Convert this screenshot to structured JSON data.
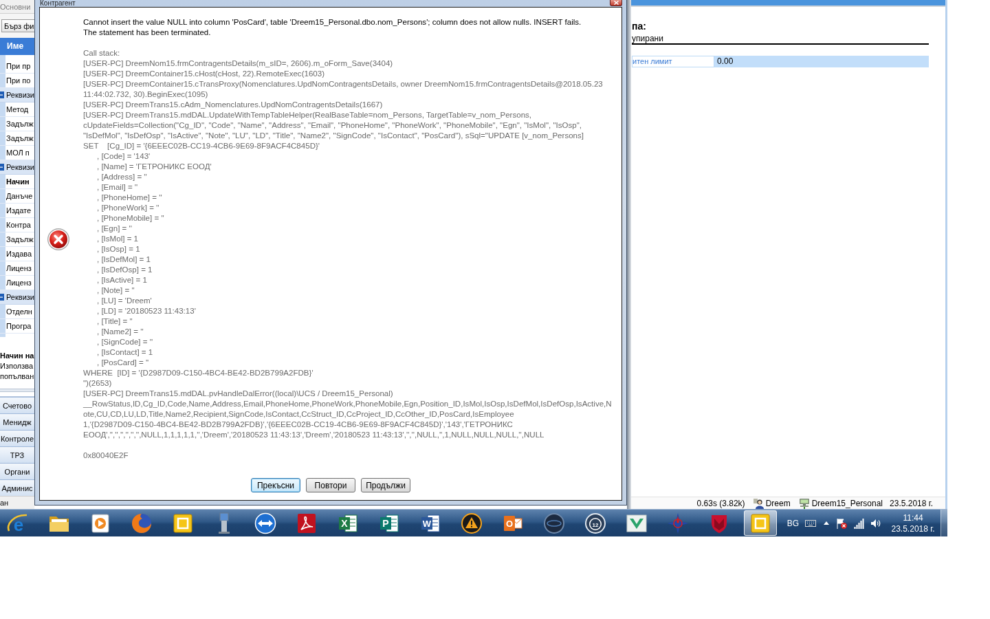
{
  "left_window": {
    "tab": "Основни",
    "quick_filter": "Бърз фи",
    "column_header": "Име",
    "rows": [
      {
        "label": "При пр",
        "kind": "item",
        "selected": false
      },
      {
        "label": "При по",
        "kind": "item",
        "selected": false
      },
      {
        "label": "Реквизи",
        "kind": "group",
        "selected": false,
        "expanded": true,
        "children": [
          {
            "label": "Метод",
            "kind": "item",
            "selected": false
          },
          {
            "label": "Задълж",
            "kind": "item",
            "selected": false
          },
          {
            "label": "Задълж",
            "kind": "item",
            "selected": false
          },
          {
            "label": "МОЛ п",
            "kind": "item",
            "selected": false
          }
        ]
      },
      {
        "label": "Реквизи",
        "kind": "group",
        "selected": false,
        "expanded": true,
        "children": [
          {
            "label": "Начин",
            "kind": "item",
            "selected": true
          },
          {
            "label": "Данъче",
            "kind": "item",
            "selected": false
          },
          {
            "label": "Издате",
            "kind": "item",
            "selected": false
          },
          {
            "label": "Контра",
            "kind": "item",
            "selected": false
          },
          {
            "label": "Задълж",
            "kind": "item",
            "selected": false
          },
          {
            "label": "Издава",
            "kind": "item",
            "selected": false
          },
          {
            "label": "Лиценз",
            "kind": "item",
            "selected": false
          },
          {
            "label": "Лиценз",
            "kind": "item",
            "selected": false
          }
        ]
      },
      {
        "label": "Реквизи",
        "kind": "group",
        "selected": false,
        "expanded": true,
        "children": [
          {
            "label": "Отделн",
            "kind": "item",
            "selected": false
          },
          {
            "label": "Програ",
            "kind": "item",
            "selected": false
          }
        ]
      }
    ],
    "description": {
      "title": "Начин на",
      "lines": [
        "Използва",
        "попълван"
      ]
    },
    "nav_buttons": [
      "Счетово",
      "Менидж",
      "Контроле",
      "ТРЗ",
      "Органи",
      "Админис"
    ],
    "status": "ан"
  },
  "dialog": {
    "title": "Контрагент",
    "message": [
      "Cannot insert the value NULL into column 'PosCard', table 'Dreem15_Personal.dbo.nom_Persons'; column does not allow nulls. INSERT fails.",
      "The statement has been terminated."
    ],
    "call_stack": {
      "heading": "Call stack:",
      "lines": [
        {
          "text": "[USER-PC] DreemNom15.frmContragentsDetails(m_sID=, 2606).m_oForm_Save(3404)",
          "kind": "plain"
        },
        {
          "text": "[USER-PC] DreemContainer15.cHost(cHost, 22).RemoteExec(1603)",
          "kind": "plain"
        },
        {
          "text": "[USER-PC] DreemContainer15.cTransProxy(Nomenclatures.UpdNomContragentsDetails, owner DreemNom15.frmContragentsDetails@2018.05.23",
          "kind": "plain"
        },
        {
          "text": "11:44:02.732, 30).BeginExec(1095)",
          "kind": "plain"
        },
        {
          "text": "[USER-PC] DreemTrans15.cAdm_Nomenclatures.UpdNomContragentsDetails(1667)",
          "kind": "plain"
        },
        {
          "text": "[USER-PC] DreemTrans15.mdDAL.UpdateWithTempTableHelper(RealBaseTable=nom_Persons, TargetTable=v_nom_Persons,",
          "kind": "plain"
        },
        {
          "text": "cUpdateFields=Collection(\"Cg_ID\", \"Code\", \"Name\", \"Address\", \"Email\", \"PhoneHome\", \"PhoneWork\", \"PhoneMobile\", \"Egn\", \"IsMol\", \"IsOsp\",",
          "kind": "plain"
        },
        {
          "text": "\"IsDefMol\", \"IsDefOsp\", \"IsActive\", \"Note\", \"LU\", \"LD\", \"Title\", \"Name2\", \"SignCode\", \"IsContact\", \"PosCard\"), sSql=\"UPDATE [v_nom_Persons]",
          "kind": "plain"
        },
        {
          "text": "SET    [Cg_ID] = '{6EEEC02B-CC19-4CB6-9E69-8F9ACF4C845D}'",
          "kind": "plain"
        },
        {
          "text": ", [Code] = '143'",
          "kind": "indented"
        },
        {
          "text": ", [Name] = 'ГЕТРОНИКС ЕООД'",
          "kind": "indented"
        },
        {
          "text": ", [Address] = ''",
          "kind": "indented"
        },
        {
          "text": ", [Email] = ''",
          "kind": "indented"
        },
        {
          "text": ", [PhoneHome] = ''",
          "kind": "indented"
        },
        {
          "text": ", [PhoneWork] = ''",
          "kind": "indented"
        },
        {
          "text": ", [PhoneMobile] = ''",
          "kind": "indented"
        },
        {
          "text": ", [Egn] = ''",
          "kind": "indented"
        },
        {
          "text": ", [IsMol] = 1",
          "kind": "indented"
        },
        {
          "text": ", [IsOsp] = 1",
          "kind": "indented"
        },
        {
          "text": ", [IsDefMol] = 1",
          "kind": "indented"
        },
        {
          "text": ", [IsDefOsp] = 1",
          "kind": "indented"
        },
        {
          "text": ", [IsActive] = 1",
          "kind": "indented"
        },
        {
          "text": ", [Note] = ''",
          "kind": "indented"
        },
        {
          "text": ", [LU] = 'Dreem'",
          "kind": "indented"
        },
        {
          "text": ", [LD] = '20180523 11:43:13'",
          "kind": "indented"
        },
        {
          "text": ", [Title] = ''",
          "kind": "indented"
        },
        {
          "text": ", [Name2] = ''",
          "kind": "indented"
        },
        {
          "text": ", [SignCode] = ''",
          "kind": "indented"
        },
        {
          "text": ", [IsContact] = 1",
          "kind": "indented"
        },
        {
          "text": ", [PosCard] = ''",
          "kind": "indented"
        },
        {
          "text": "WHERE  [ID] = '{D2987D09-C150-4BC4-BE42-BD2B799A2FDB}'",
          "kind": "plain"
        },
        {
          "text": "\")(2653)",
          "kind": "plain"
        },
        {
          "text": "[USER-PC] DreemTrans15.mdDAL.pvHandleDalError((local)\\UCS / Dreem15_Personal)",
          "kind": "plain"
        },
        {
          "text": "__RowStatus,ID,Cg_ID,Code,Name,Address,Email,PhoneHome,PhoneWork,PhoneMobile,Egn,Position_ID,IsMol,IsOsp,IsDefMol,IsDefOsp,IsActive,N",
          "kind": "plain"
        },
        {
          "text": "ote,CU,CD,LU,LD,Title,Name2,Recipient,SignCode,IsContact,CcStruct_ID,CcProject_ID,CcOther_ID,PosCard,IsEmployee",
          "kind": "plain"
        },
        {
          "text": "1,'{D2987D09-C150-4BC4-BE42-BD2B799A2FDB}','{6EEEC02B-CC19-4CB6-9E69-8F9ACF4C845D}','143','ГЕТРОНИКС",
          "kind": "plain"
        },
        {
          "text": "ЕООД','','','','','','',NULL,1,1,1,1,1,'','Dreem','20180523 11:43:13','Dreem','20180523 11:43:13','','',NULL,'',1,NULL,NULL,NULL,'',NULL",
          "kind": "plain"
        }
      ]
    },
    "error_code": "0x80040E2F",
    "buttons": [
      {
        "label": "Прекъсни",
        "default": true
      },
      {
        "label": "Повтори",
        "default": false
      },
      {
        "label": "Продължи",
        "default": false
      }
    ]
  },
  "right_window": {
    "section_label": "па:",
    "field_value": "упирани",
    "rows": [
      {
        "label": "итен лимит",
        "value": "0.00"
      }
    ],
    "status_bar": {
      "timing": "0.63s (3.82k)",
      "user": "Dreem",
      "database": "Dreem15_Personal",
      "date": "23.5.2018 г."
    }
  },
  "taskbar": {
    "apps": [
      {
        "kind": "browser",
        "glyph": "e",
        "selected": false
      },
      {
        "kind": "folder",
        "selected": false
      },
      {
        "kind": "media",
        "selected": false
      },
      {
        "kind": "fox",
        "selected": false
      },
      {
        "kind": "tile",
        "selected": false
      },
      {
        "kind": "kiosk",
        "selected": false
      },
      {
        "kind": "arrows",
        "selected": false
      },
      {
        "kind": "pdf",
        "selected": false
      },
      {
        "kind": "sheet",
        "glyph": "X",
        "selected": false
      },
      {
        "kind": "publisher",
        "glyph": "P",
        "selected": false
      },
      {
        "kind": "document",
        "glyph": "W",
        "selected": false
      },
      {
        "kind": "warning",
        "selected": false
      },
      {
        "kind": "mail",
        "glyph": "O",
        "selected": false
      },
      {
        "kind": "disc",
        "selected": false
      },
      {
        "kind": "badge",
        "glyph": "12",
        "selected": false
      },
      {
        "kind": "chevron",
        "selected": false
      },
      {
        "kind": "compass",
        "selected": false
      },
      {
        "kind": "shield",
        "selected": false
      },
      {
        "kind": "tile",
        "selected": true
      }
    ],
    "tray": {
      "language": "BG",
      "time": "11:44",
      "date": "23.5.2018 г."
    }
  }
}
